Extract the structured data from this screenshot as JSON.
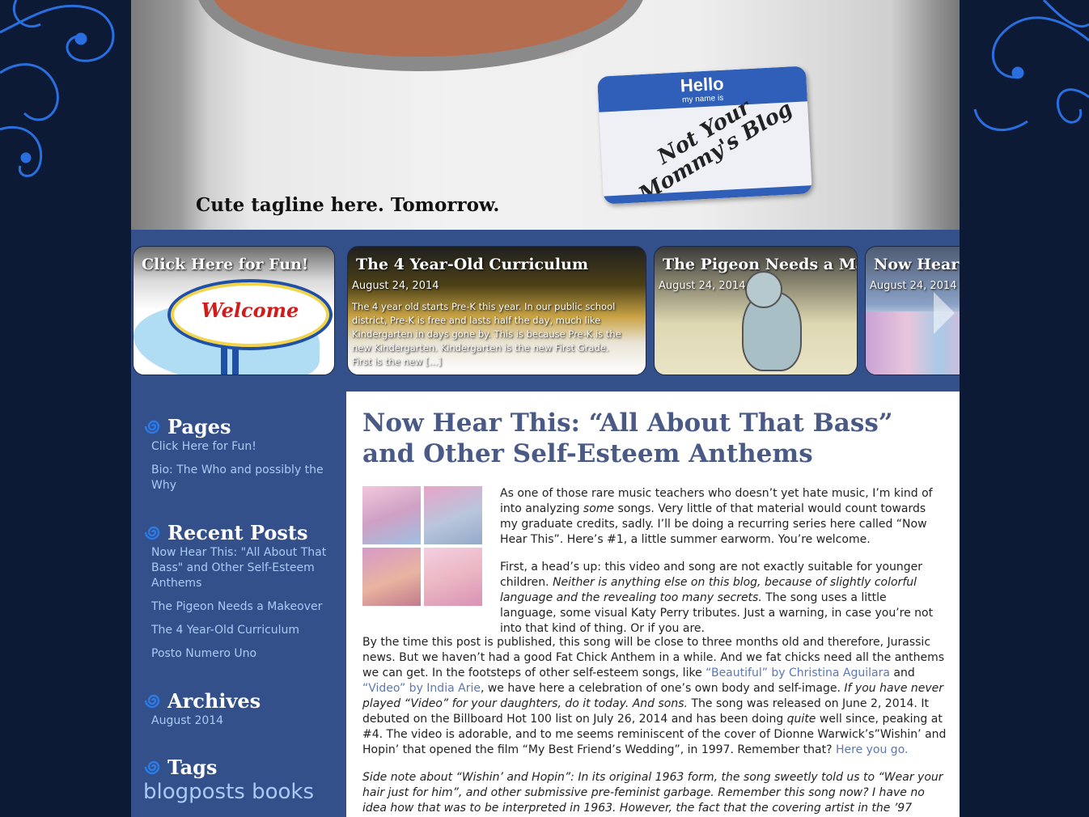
{
  "header": {
    "nametag_hello": "Hello",
    "nametag_sub": "my name is",
    "nametag_name": "Not Your Mommy's Blog",
    "tagline": "Cute tagline here. Tomorrow."
  },
  "slider": {
    "slides": [
      {
        "title": "Click Here for Fun!",
        "sign_text": "Welcome"
      },
      {
        "title": "The 4 Year-Old Curriculum",
        "date": "August 24, 2014",
        "excerpt": "The 4 year old starts Pre-K this year. In our public school district, Pre-K is free and lasts half the day, much like Kindergarten in days gone by. This is because Pre-K is the new Kindergarten. Kindergarten is the new First Grade. First is the new [...]"
      },
      {
        "title": "The Pigeon Needs a Makeover",
        "date": "August 24, 2014"
      },
      {
        "title": "Now Hear This",
        "date": "August 24, 2014"
      }
    ]
  },
  "sidebar": {
    "pages": {
      "title": "Pages",
      "items": [
        "Click Here for Fun!",
        "Bio: The Who and possibly the Why"
      ]
    },
    "recent": {
      "title": "Recent Posts",
      "items": [
        "Now Hear This: \"All About That Bass\" and Other Self-Esteem Anthems",
        "The Pigeon Needs a Makeover",
        "The 4 Year-Old Curriculum",
        "Posto Numero Uno"
      ]
    },
    "archives": {
      "title": "Archives",
      "items": [
        "August 2014"
      ]
    },
    "tags": {
      "title": "Tags",
      "items": [
        "blogposts",
        "books"
      ]
    }
  },
  "post": {
    "title": "Now Hear This: “All About That Bass” and Other Self-Esteem Anthems",
    "p1_a": "As one of those rare music teachers who doesn’t yet hate music, I’m kind of into analyzing ",
    "p1_em": "some",
    "p1_b": " songs. Very little of that material would count towards my graduate credits, sadly. I’ll be doing a recurring series here called “Now Hear This”.  Here’s #1, a little summer earworm. You’re welcome.",
    "p2_a": "First, a head’s up: this video and song are not exactly suitable for younger children. ",
    "p2_em": "Neither is anything else on this blog, because of slightly colorful language and the revealing too many secrets.",
    "p2_b": " The song uses a little language, some visual Katy Perry tributes.  Just a warning, in case you’re not into that kind of thing. Or if you are.",
    "p3_a": "By the time this post is published, this song will be close to three months old and therefore, Jurassic news. But we haven’t had a good Fat Chick Anthem in a while. And we fat chicks need all the anthems we can get. In the footsteps of other self-esteem songs, like ",
    "p3_link1": "“Beautiful” by Christina Aguilara",
    "p3_b": " and ",
    "p3_link2": "“Video” by India Arie",
    "p3_c": ", we have here a celebration of one’s own body and self-image. ",
    "p3_em1": "If you have never played “Video” for your daughters, do it today. And sons.",
    "p3_d": "  The song was released on June 2, 2014. It debuted on the Billboard Hot 100 list on July 26, 2014 and has been doing ",
    "p3_em2": "quite",
    "p3_e": " well since, peaking at #4.  The video is adorable, and to me seems reminiscent of the cover of Dionne Warwick’s”Wishin’ and Hopin’ that opened the film “My Best Friend’s Wedding”, in 1997. Remember that? ",
    "p3_link3": "Here you go.",
    "p4_em": "Side note about “Wishin’ and Hopin”: In its original 1963 form, the song sweetly told us to “Wear your hair just for him”, and other submissive pre-feminist garbage. Remember this song now? I have no idea how that was to be interpreted in 1963. However, the fact that the covering artist in the ’97 version is Ani DiFranco, in all her"
  },
  "colors": {
    "background": "#0c1a36",
    "slider_bg": "#34508a",
    "sidebar_link": "#a8cbf6",
    "post_title": "#4a5a86",
    "content_link": "#5b77b4",
    "swirl": "#2a6fe0"
  }
}
